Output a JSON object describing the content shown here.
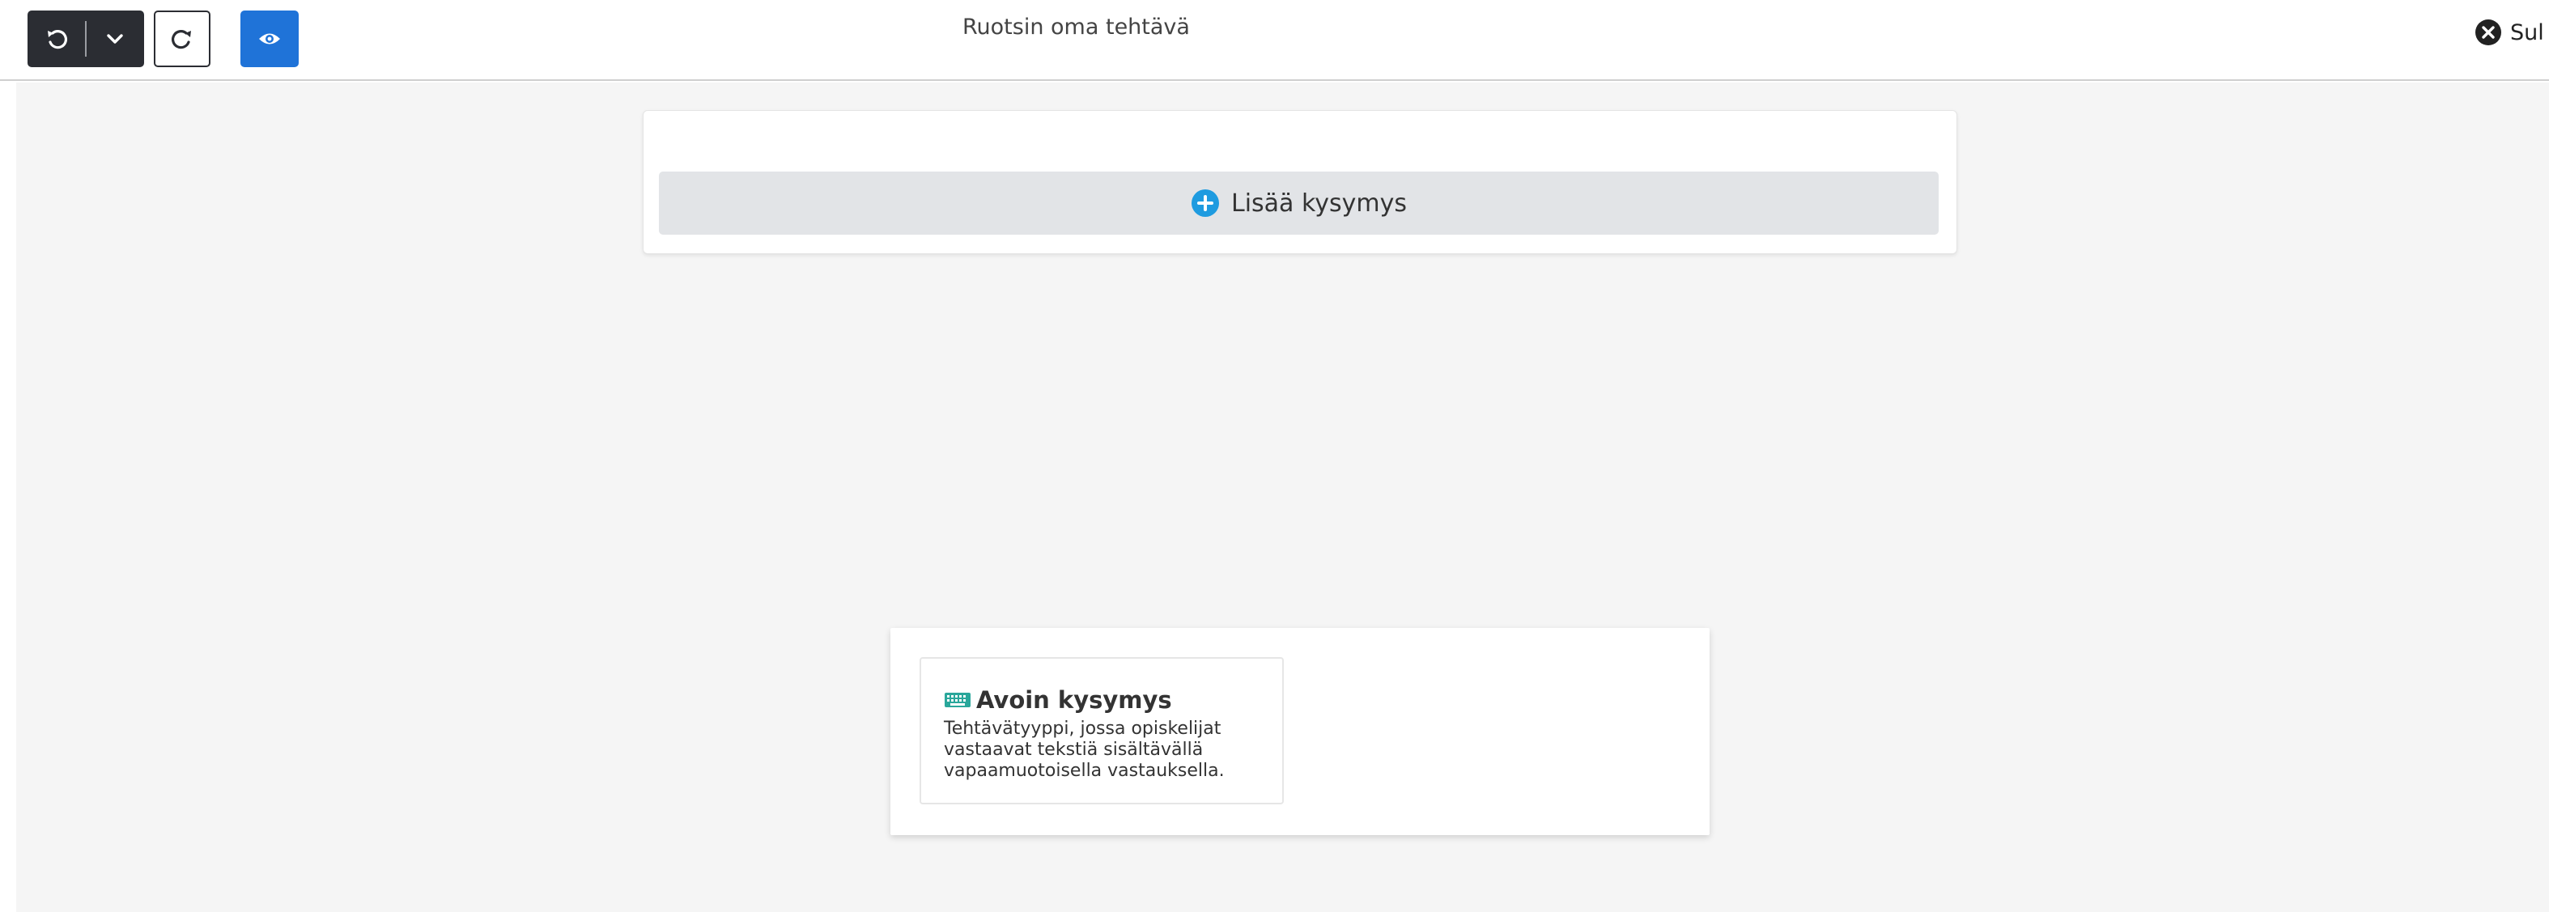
{
  "toolbar": {
    "title": "Ruotsin oma tehtävä",
    "close_label": "Sul"
  },
  "question_editor": {
    "add_question_label": "Lisää kysymys"
  },
  "question_types": [
    {
      "icon": "keyboard-icon",
      "title": "Avoin kysymys",
      "description": "Tehtävätyyppi, jossa opiskelijat vastaavat tekstiä sisältävällä vapaamuotoisella vastauksella."
    }
  ],
  "colors": {
    "dark_button": "#2b2d33",
    "primary_blue": "#1f73d8",
    "add_icon_blue": "#1e9be0",
    "workspace_bg": "#f5f5f5",
    "add_button_bg": "#e2e4e7"
  }
}
